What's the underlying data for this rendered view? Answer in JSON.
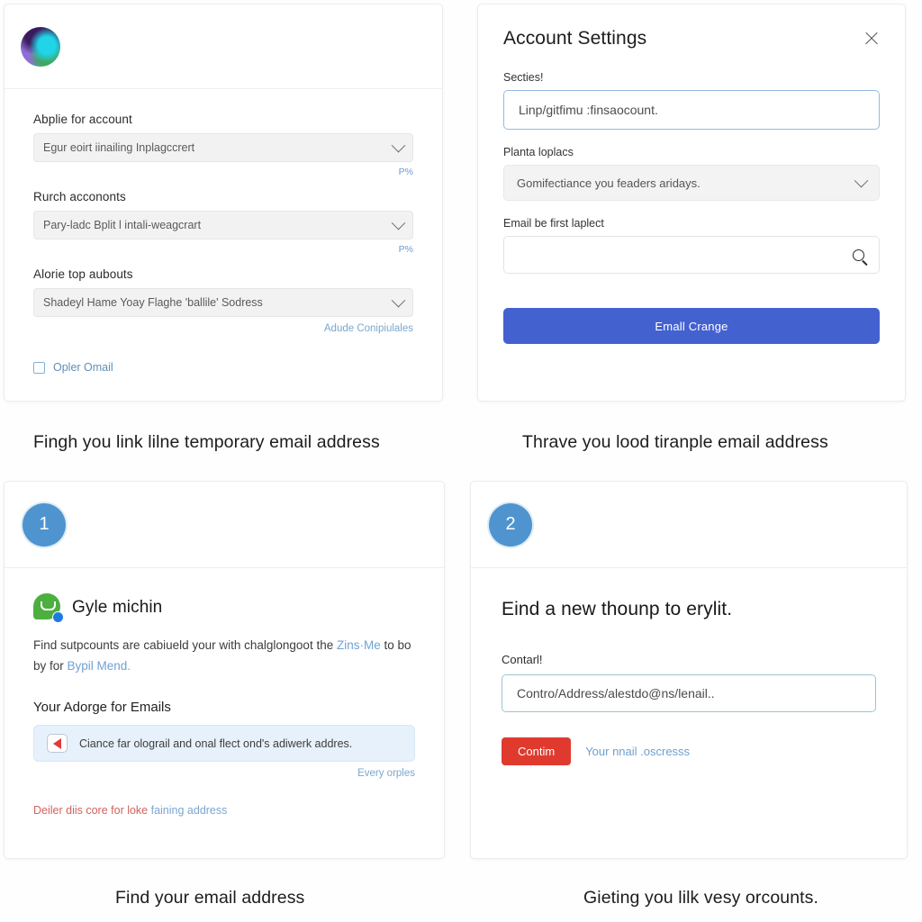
{
  "colors": {
    "primary_button": "#4461d0",
    "danger_button": "#e03a2f",
    "badge_blue": "#4f94ce",
    "link_blue": "#7ba7cf",
    "warn_red": "#d2615f",
    "chat_green": "#4caf3f",
    "info_bg": "#e6f1fb"
  },
  "card1": {
    "logo": "colorful-orb-logo",
    "fields": [
      {
        "label": "Abplie for account",
        "value": "Egur eoirt iinailing Inplagccrert",
        "mini_link": "P%"
      },
      {
        "label": "Rurch accononts",
        "value": "Pary-ladc Bplit l intali-weagcrart",
        "mini_link": "P%"
      },
      {
        "label": "Alorie top aubouts",
        "value": "Shadeyl Hame Yoay Flaghe 'ballile' Sodress",
        "mini_link": "Adude Conipiulales"
      }
    ],
    "checkbox_label": "Opler Omail",
    "checkbox_checked": false,
    "caption": "Fingh you link lilne temporary email address"
  },
  "card2": {
    "title": "Account Settings",
    "close_icon": "close-icon",
    "field1_label": "Secties!",
    "field1_value": "Linp/gitfimu :finsaocount.",
    "field2_label": "Planta loplacs",
    "field2_value": "Gomifectiance you feaders aridays.",
    "field3_label": "Email be first laplect",
    "field3_value": "",
    "search_icon": "search-icon",
    "submit_label": "Emall Crange",
    "caption": "Thrave you lood tiranple email address"
  },
  "card3": {
    "step_number": "1",
    "brand_icon": "chat-bubble-icon",
    "brand_name": "Gyle michin",
    "paragraph_part1": "Find sutpcounts are cabiueld your with chalglongoot the ",
    "paragraph_link1": "Zins·Me",
    "paragraph_part2": " to bo by for ",
    "paragraph_link2": "Bypil Mend.",
    "section_label": "Your Adorge for Emails",
    "info_icon": "red-play-icon",
    "info_text": "Ciance far olograil and onal flect ond's adiwerk addres.",
    "info_link": "Every orples",
    "warn_text": "Deiler diis core for loke ",
    "warn_link": "faining address",
    "caption": "Find your email address"
  },
  "card4": {
    "step_number": "2",
    "heading": "Eind a new thounp to erylit.",
    "field_label": "Contarl!",
    "field_value": "Contro/Address/alestdo@ns/lenail..",
    "confirm_label": "Contim",
    "side_link": "Your nnail .oscresss",
    "caption": "Gieting you lilk vesy orcounts."
  }
}
